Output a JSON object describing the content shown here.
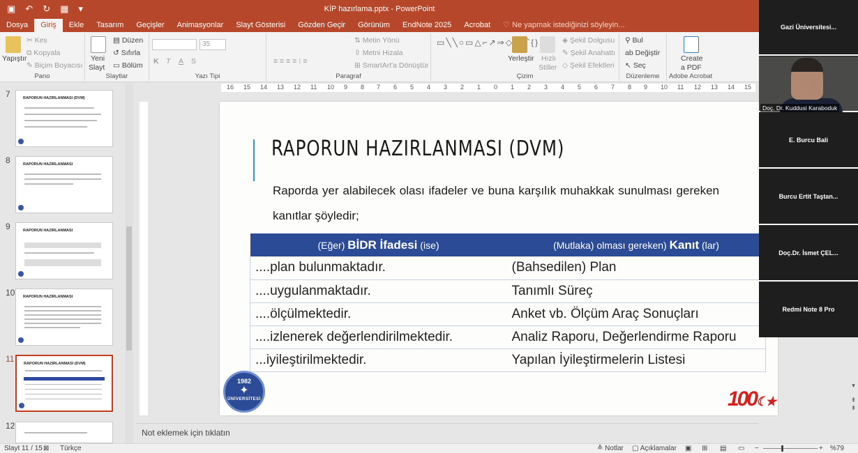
{
  "window": {
    "title": "KİP hazırlama.pptx - PowerPoint"
  },
  "tabs": [
    {
      "label": "Dosya"
    },
    {
      "label": "Giriş"
    },
    {
      "label": "Ekle"
    },
    {
      "label": "Tasarım"
    },
    {
      "label": "Geçişler"
    },
    {
      "label": "Animasyonlar"
    },
    {
      "label": "Slayt Gösterisi"
    },
    {
      "label": "Gözden Geçir"
    },
    {
      "label": "Görünüm"
    },
    {
      "label": "EndNote 2025"
    },
    {
      "label": "Acrobat"
    }
  ],
  "tell_me": "Ne yapmak istediğinizi söyleyin...",
  "ribbon": {
    "pano": {
      "label": "Pano",
      "paste": "Yapıştır",
      "cut": "Kes",
      "copy": "Kopyala",
      "format_painter": "Biçim Boyacısı"
    },
    "slides": {
      "label": "Slaytlar",
      "new_slide_1": "Yeni",
      "new_slide_2": "Slayt",
      "layout": "Düzen",
      "reset": "Sıfırla",
      "section": "Bölüm"
    },
    "font": {
      "label": "Yazı Tipi",
      "size": "35",
      "bold": "K",
      "italic": "T",
      "underline": "A",
      "shadow": "S"
    },
    "paragraph": {
      "label": "Paragraf",
      "text_direction": "Metin Yönü",
      "align_text": "Metni Hizala",
      "smartart": "SmartArt'a Dönüştür"
    },
    "drawing": {
      "label": "Çizim",
      "arrange_1": "Yerleştir",
      "quick_styles_1": "Hızlı",
      "quick_styles_2": "Stiller",
      "fill": "Şekil Dolgusu",
      "outline": "Şekil Anahattı",
      "effects": "Şekil Efektleri"
    },
    "editing": {
      "label": "Düzenleme",
      "find": "Bul",
      "replace": "Değiştir",
      "select": "Seç"
    },
    "acrobat": {
      "label": "Adobe Acrobat",
      "create_1": "Create",
      "create_2": "a PDF"
    }
  },
  "thumbnails": [
    {
      "number": "7",
      "title": "RAPORUN HAZIRLANMASI (DVM)"
    },
    {
      "number": "8",
      "title": "RAPORUN HAZIRLANMASI"
    },
    {
      "number": "9",
      "title": "RAPORUN HAZIRLANMASI"
    },
    {
      "number": "10",
      "title": "RAPORUN HAZIRLANMASI"
    },
    {
      "number": "11",
      "title": "RAPORUN HAZIRLANMASI (DVM)"
    },
    {
      "number": "12",
      "title": ""
    }
  ],
  "ruler": {
    "h_labels": [
      "16",
      "15",
      "14",
      "13",
      "12",
      "11",
      "10",
      "9",
      "8",
      "7",
      "6",
      "5",
      "4",
      "3",
      "2",
      "1",
      "0",
      "1",
      "2",
      "3",
      "4",
      "5",
      "6",
      "7",
      "8",
      "9",
      "10",
      "11",
      "12",
      "13",
      "14",
      "15"
    ]
  },
  "slide": {
    "title": "RAPORUN HAZIRLANMASI (DVM)",
    "subtitle": "Raporda yer alabilecek olası ifadeler ve buna karşılık muhakkak sunulması gereken kanıtlar şöyledir;",
    "table": {
      "col1_prefix": "(Eğer)",
      "col1_bold": "BİDR İfadesi",
      "col1_suffix": "(ise)",
      "col2_prefix": "(Mutlaka) olması gereken)",
      "col2_bold": "Kanıt",
      "col2_suffix": "(lar)",
      "rows": [
        [
          "....plan bulunmaktadır.",
          "(Bahsedilen) Plan"
        ],
        [
          "....uygulanmaktadır.",
          "Tanımlı Süreç"
        ],
        [
          "....ölçülmektedir.",
          "Anket vb. Ölçüm Araç Sonuçları"
        ],
        [
          "....izlenerek değerlendirilmektedir.",
          "Analiz Raporu, Değerlendirme Raporu"
        ],
        [
          "...iyileştirilmektedir.",
          "Yapılan İyileştirmelerin Listesi"
        ]
      ]
    },
    "seal_year": "1982",
    "seal_text": "ÜNİVERSİTESİ",
    "anniversary": "100"
  },
  "notes_placeholder": "Not eklemek için tıklatın",
  "status": {
    "slide": "Slayt 11 / 15",
    "language": "Türkçe",
    "notes": "Notlar",
    "comments": "Açıklamalar",
    "zoom": "%79"
  },
  "participants": [
    {
      "name": "Gazi  Üniversitesi..."
    },
    {
      "name": "Doç. Dr. Kuddusi Karaboduk"
    },
    {
      "name": "E. Burcu Bali"
    },
    {
      "name": "Burcu  Ertit  Taştan..."
    },
    {
      "name": "Doç.Dr.  İsmet  ÇEL..."
    },
    {
      "name": "Redmi Note 8 Pro"
    }
  ]
}
